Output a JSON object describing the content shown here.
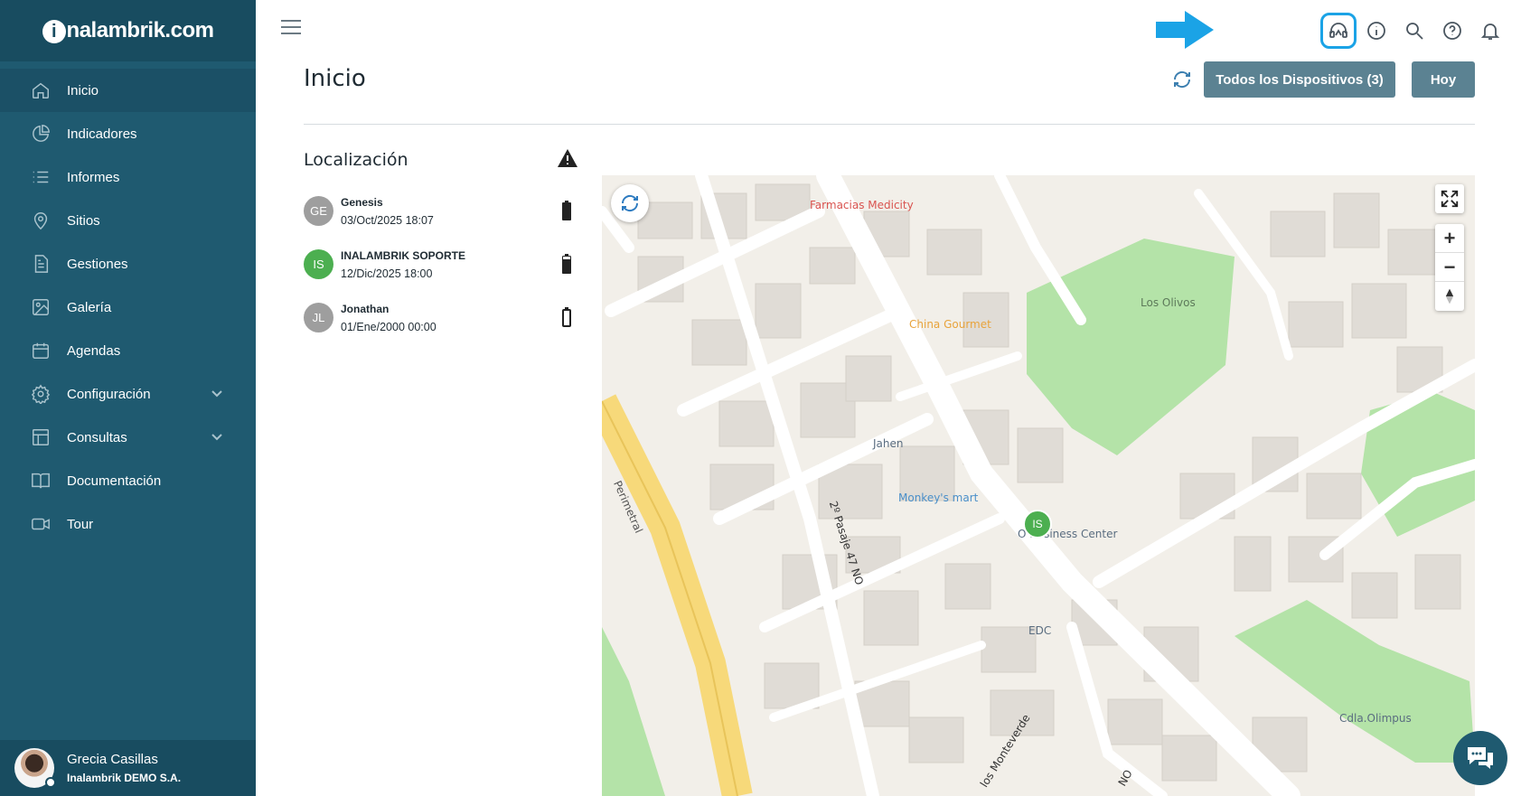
{
  "brand": {
    "logo_i": "i",
    "logo_rest": "nalambrik.com"
  },
  "sidebar": {
    "items": [
      {
        "label": "Inicio",
        "icon": "home-icon",
        "active": true
      },
      {
        "label": "Indicadores",
        "icon": "pie-chart-icon"
      },
      {
        "label": "Informes",
        "icon": "list-icon"
      },
      {
        "label": "Sitios",
        "icon": "map-pin-icon"
      },
      {
        "label": "Gestiones",
        "icon": "document-icon"
      },
      {
        "label": "Galería",
        "icon": "image-icon"
      },
      {
        "label": "Agendas",
        "icon": "calendar-icon"
      },
      {
        "label": "Configuración",
        "icon": "gear-icon",
        "expandable": true
      },
      {
        "label": "Consultas",
        "icon": "table-icon",
        "expandable": true
      },
      {
        "label": "Documentación",
        "icon": "book-icon"
      },
      {
        "label": "Tour",
        "icon": "video-icon"
      }
    ],
    "user": {
      "name": "Grecia Casillas",
      "org": "Inalambrik DEMO S.A."
    }
  },
  "header": {
    "icons": [
      "support-headset-icon",
      "info-icon",
      "search-icon",
      "help-icon",
      "bell-icon"
    ],
    "highlight_color": "#1ba3e6"
  },
  "page": {
    "title": "Inicio",
    "devices_button": "Todos los Dispositivos (3)",
    "today_button": "Hoy"
  },
  "location": {
    "title": "Localización",
    "devices": [
      {
        "initials": "GE",
        "name": "Genesis",
        "date": "03/Oct/2025 18:07",
        "color": "#9e9e9e",
        "battery": "full"
      },
      {
        "initials": "IS",
        "name": "INALAMBRIK SOPORTE",
        "date": "12/Dic/2025 18:00",
        "color": "#4caf50",
        "battery": "high"
      },
      {
        "initials": "JL",
        "name": "Jonathan",
        "date": "01/Ene/2000 00:00",
        "color": "#9e9e9e",
        "battery": "empty"
      }
    ]
  },
  "map": {
    "labels": {
      "pharmacy": "Farmacias Medicity",
      "restaurant": "China Gourmet",
      "park": "Los Olivos",
      "jahen": "Jahen",
      "mart": "Monkey's mart",
      "business": "O   Business Center",
      "edc": "EDC",
      "cdla": "Cdla.Olimpus",
      "street1": "2º Pasaje 47 NO",
      "street2": "Perimetral",
      "street3": "los Monteverde",
      "street4": "NO"
    },
    "marker": "IS"
  }
}
